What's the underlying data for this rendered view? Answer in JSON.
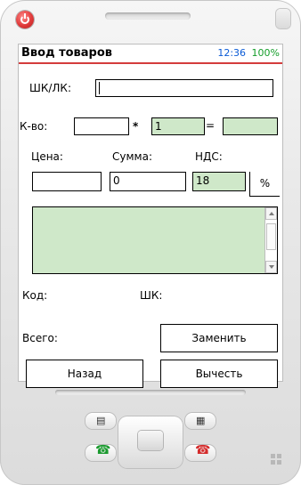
{
  "app": {
    "title": "Ввод товаров",
    "time": "12:36",
    "battery": "100%"
  },
  "form": {
    "barcode_label": "ШК/ЛК:",
    "barcode_value": "",
    "qty_label": "К-во:",
    "qty_value": "",
    "multiply_symbol": "*",
    "multiplier_value": "1",
    "equals_symbol": "=",
    "result_value": "",
    "price_label": "Цена:",
    "price_value": "",
    "sum_label": "Сумма:",
    "sum_value": "0",
    "vat_label": "НДС:",
    "vat_value": "18",
    "vat_unit": "%"
  },
  "info": {
    "code_label": "Код:",
    "code_value": "",
    "sk_label": "ШК:",
    "sk_value": "",
    "total_label": "Всего:",
    "total_value": ""
  },
  "buttons": {
    "replace": "Заменить",
    "back": "Назад",
    "subtract": "Вычесть"
  },
  "colors": {
    "accent_red": "#d43c3c",
    "time_blue": "#0b5bd6",
    "battery_green": "#149d2a",
    "field_green": "#cfe8c9"
  },
  "icons": {
    "power": "power-icon",
    "dpad": "dpad-icon",
    "call": "call-icon",
    "end_call": "end-call-icon",
    "left_soft": "left-softkey-icon",
    "right_soft": "right-softkey-icon",
    "windows": "windows-logo"
  }
}
